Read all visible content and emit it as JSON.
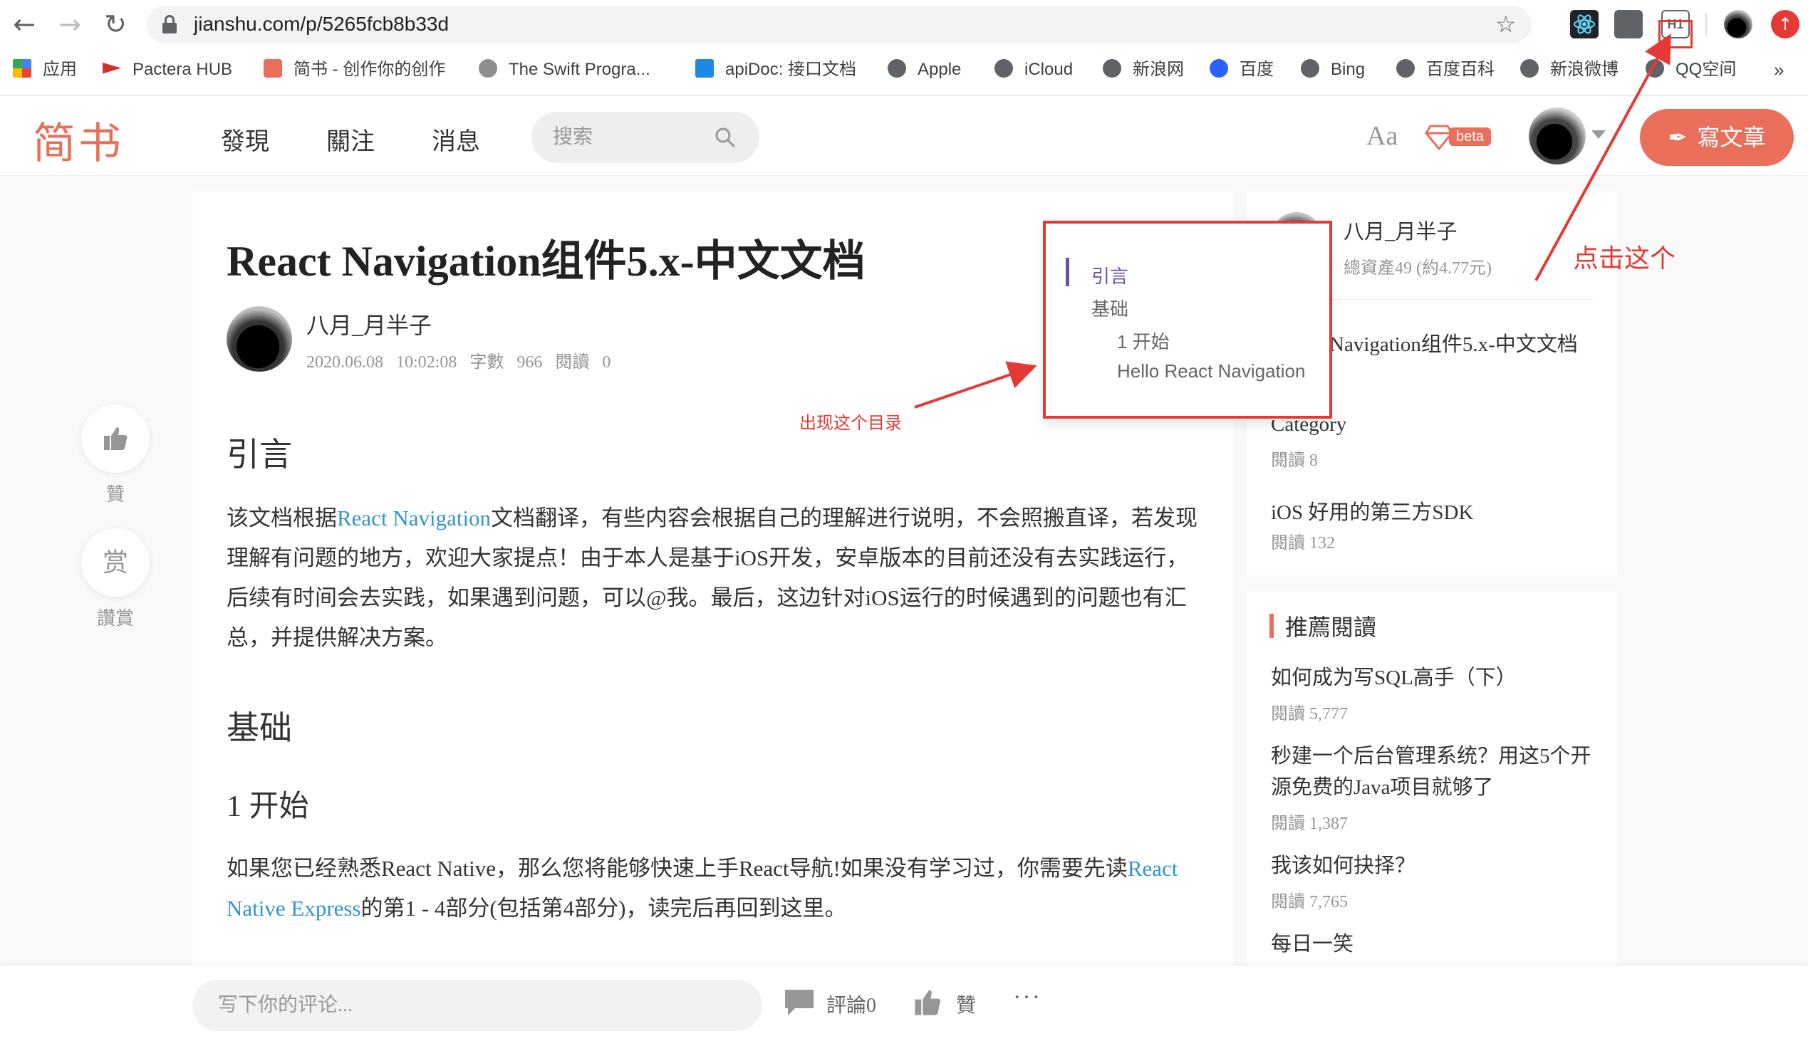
{
  "browser": {
    "url": "jianshu.com/p/5265fcb8b33d",
    "bookmarks": [
      "应用",
      "Pactera HUB",
      "简书 - 创作你的创作",
      "The Swift Progra...",
      "apiDoc: 接口文档",
      "Apple",
      "iCloud",
      "新浪网",
      "百度",
      "Bing",
      "百度百科",
      "新浪微博",
      "QQ空间"
    ],
    "more": "»",
    "ext_h1": "H1"
  },
  "site": {
    "logo": "简书",
    "nav": [
      "發現",
      "關注",
      "消息"
    ],
    "search_placeholder": "搜索",
    "aa": "Aa",
    "beta": "beta",
    "write": "寫文章"
  },
  "article": {
    "title": "React Navigation组件5.x-中文文档",
    "author": "八月_月半子",
    "meta": "2020.06.08 10:02:08   字數 966   閱讀 0",
    "h_intro": "引言",
    "p1_a": "该文档根据",
    "p1_link": "React Navigation",
    "p1_b": "文档翻译，有些内容会根据自己的理解进行说明，不会照搬直译，若发现理解有问题的地方，欢迎大家提点！由于本人是基于iOS开发，安卓版本的目前还没有去实践运行，后续有时间会去实践，如果遇到问题，可以@我。最后，这边针对iOS运行的时候遇到的问题也有汇总，并提供解决方案。",
    "h_basic": "基础",
    "h_start": "1 开始",
    "p2_a": "如果您已经熟悉React Native，那么您将能够快速上手React导航!如果没有学习过，你需要先读",
    "p2_link": "React Native Express",
    "p2_b": "的第1 - 4部分(包括第4部分)，读完后再回到这里。"
  },
  "actions": {
    "like": "贊",
    "reward_icon": "赏",
    "reward": "讚賞"
  },
  "sidebar": {
    "name": "八月_月半子",
    "assets": "總資產49 (約4.77元)",
    "items": [
      {
        "title": "Navigation组件5.x-中文文档",
        "meta": ""
      },
      {
        "title": "Category",
        "meta": "閱讀 8"
      },
      {
        "title": "iOS 好用的第三方SDK",
        "meta": "閱讀 132"
      }
    ]
  },
  "recommend": {
    "title": "推薦閱讀",
    "items": [
      {
        "title": "如何成为写SQL高手（下）",
        "meta": "閱讀 5,777"
      },
      {
        "title": "秒建一个后台管理系统？用这5个开源免费的Java项目就够了",
        "meta": "閱讀 1,387"
      },
      {
        "title": "我该如何抉择？",
        "meta": "閱讀 7,765"
      },
      {
        "title": "每日一笑",
        "meta": ""
      }
    ]
  },
  "toc": [
    "引言",
    "基础",
    "1 开始",
    "Hello React Navigation"
  ],
  "annotations": {
    "toc_note": "出现这个目录",
    "click_note": "点击这个"
  },
  "bottom": {
    "comment_placeholder": "写下你的评论...",
    "comments": "評論0",
    "like": "贊",
    "more": "···"
  },
  "colors": {
    "brand": "#ea6f5a",
    "link": "#3194d0",
    "annotation": "#e53935",
    "toc_accent": "#6b50a6"
  }
}
